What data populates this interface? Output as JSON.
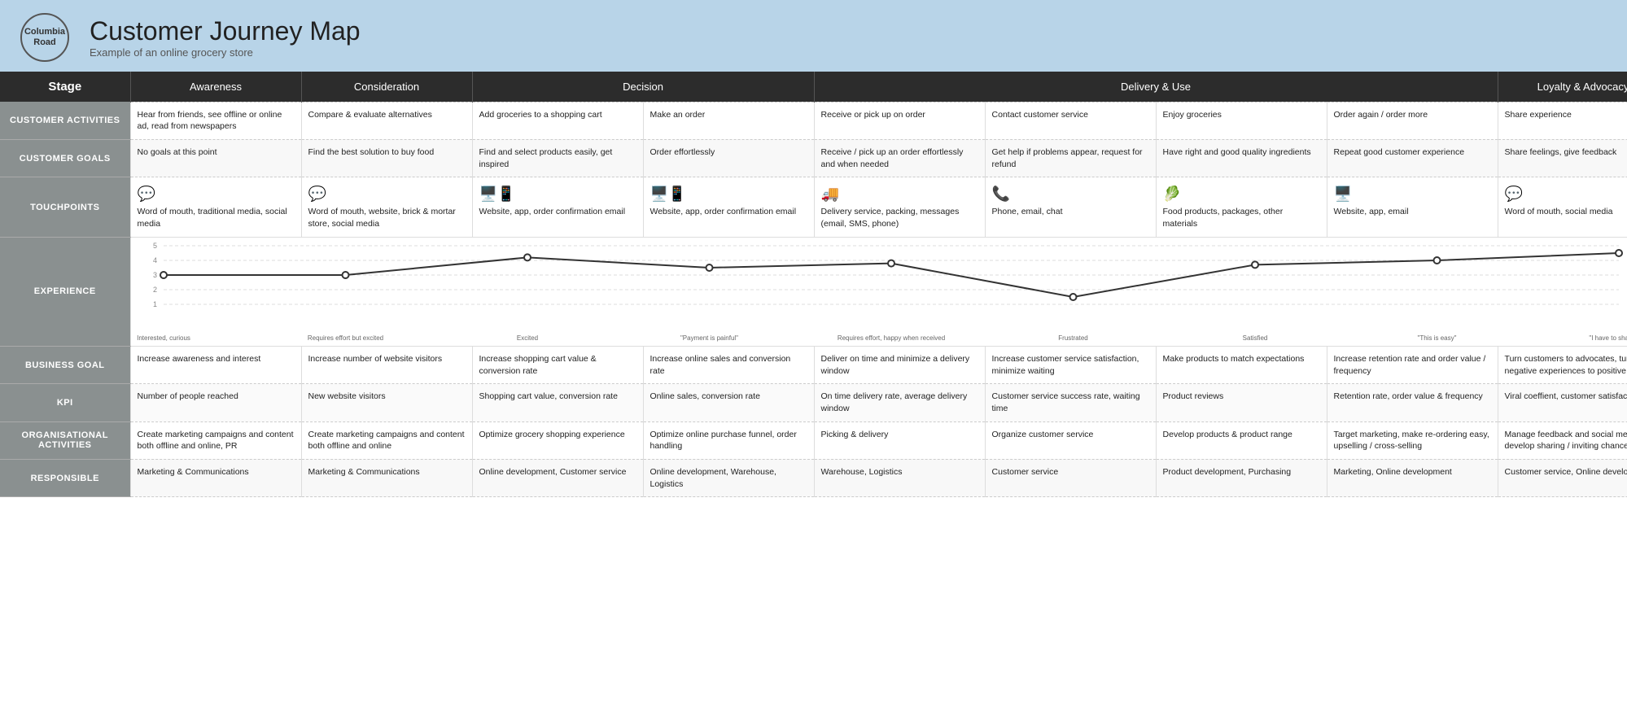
{
  "header": {
    "logo_line1": "Columbia",
    "logo_line2": "Road",
    "title": "Customer Journey Map",
    "subtitle": "Example of an online grocery store"
  },
  "stages": {
    "label": "Stage",
    "columns": [
      {
        "id": "awareness",
        "label": "Awareness",
        "span": 1
      },
      {
        "id": "consideration",
        "label": "Consideration",
        "span": 1
      },
      {
        "id": "decision",
        "label": "Decision",
        "span": 2
      },
      {
        "id": "delivery",
        "label": "Delivery & Use",
        "span": 4
      },
      {
        "id": "loyalty",
        "label": "Loyalty & Advocacy",
        "span": 2
      }
    ]
  },
  "rows": {
    "customer_activities": {
      "label": "CUSTOMER ACTIVITIES",
      "cells": [
        "Hear from friends, see offline or online ad, read from newspapers",
        "Compare & evaluate alternatives",
        "Add groceries to a shopping cart",
        "Make an order",
        "Receive or pick up on order",
        "Contact customer service",
        "Enjoy groceries",
        "Order again / order more",
        "Share experience"
      ]
    },
    "customer_goals": {
      "label": "CUSTOMER GOALS",
      "cells": [
        "No goals at this point",
        "Find the best solution to buy food",
        "Find and select products easily, get inspired",
        "Order effortlessly",
        "Receive / pick up an order effortlessly and when needed",
        "Get help if problems appear, request for refund",
        "Have right and good quality ingredients",
        "Repeat good customer experience",
        "Share feelings, give feedback"
      ]
    },
    "touchpoints": {
      "label": "TOUCHPOINTS",
      "cells": [
        "Word of mouth, traditional media, social media",
        "Word of mouth, website, brick & mortar store, social media",
        "Website, app, order confirmation email",
        "Website, app, order confirmation email",
        "Delivery service, packing, messages (email, SMS, phone)",
        "Phone, email, chat",
        "Food products, packages, other materials",
        "Website, app, email",
        "Word of mouth, social media"
      ]
    },
    "experience": {
      "label": "EXPERIENCE",
      "emotions": [
        "Interested, curious",
        "Requires effort but excited",
        "Excited",
        "\"Payment is painful\"",
        "Requires effort, happy when received",
        "Frustrated",
        "Satisfied",
        "\"This is easy\"",
        "\"I have to share this\""
      ],
      "scores": [
        3,
        3,
        4.2,
        3.5,
        3.8,
        1.5,
        3.7,
        4.0,
        4.5
      ]
    },
    "business_goal": {
      "label": "BUSINESS GOAL",
      "cells": [
        "Increase awareness and interest",
        "Increase number of website visitors",
        "Increase shopping cart value & conversion rate",
        "Increase online sales and conversion rate",
        "Deliver on time and minimize a delivery window",
        "Increase customer service satisfaction, minimize waiting",
        "Make products to match expectations",
        "Increase retention rate and order value / frequency",
        "Turn customers to advocates, turn negative experiences to positive"
      ]
    },
    "kpi": {
      "label": "KPI",
      "cells": [
        "Number of people reached",
        "New website visitors",
        "Shopping cart value, conversion rate",
        "Online sales, conversion rate",
        "On time delivery rate, average delivery window",
        "Customer service success rate, waiting time",
        "Product reviews",
        "Retention rate, order value & frequency",
        "Viral coeffient, customer satisfaction"
      ]
    },
    "org_activities": {
      "label": "ORGANISATIONAL ACTIVITIES",
      "cells": [
        "Create marketing campaigns and content both offline and online, PR",
        "Create marketing campaigns and content both offline and online",
        "Optimize grocery shopping experience",
        "Optimize online purchase funnel, order handling",
        "Picking & delivery",
        "Organize customer service",
        "Develop products & product range",
        "Target marketing, make re-ordering easy, upselling / cross-selling",
        "Manage feedback and social media, develop sharing / inviting chances"
      ]
    },
    "responsible": {
      "label": "RESPONSIBLE",
      "cells": [
        "Marketing & Communications",
        "Marketing & Communications",
        "Online development, Customer service",
        "Online development, Warehouse, Logistics",
        "Warehouse, Logistics",
        "Customer service",
        "Product development, Purchasing",
        "Marketing, Online development",
        "Customer service, Online development"
      ]
    }
  },
  "col_widths": [
    "160px",
    "210px",
    "210px",
    "210px",
    "210px",
    "210px",
    "210px",
    "210px",
    "210px",
    "210px"
  ]
}
